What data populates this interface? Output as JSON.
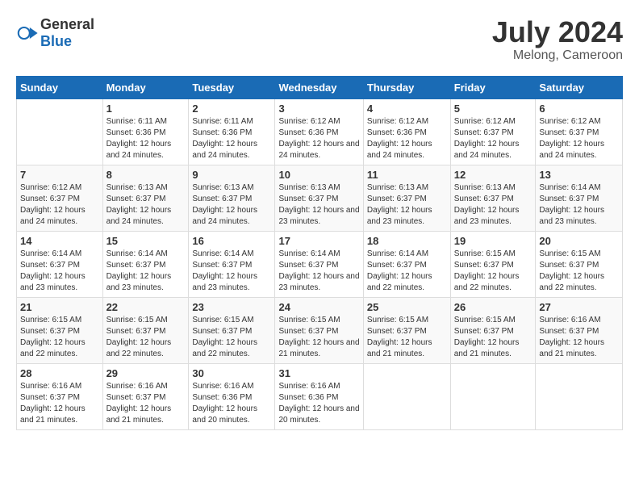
{
  "header": {
    "logo_general": "General",
    "logo_blue": "Blue",
    "month_year": "July 2024",
    "location": "Melong, Cameroon"
  },
  "weekdays": [
    "Sunday",
    "Monday",
    "Tuesday",
    "Wednesday",
    "Thursday",
    "Friday",
    "Saturday"
  ],
  "weeks": [
    [
      {
        "day": "",
        "sunrise": "",
        "sunset": "",
        "daylight": ""
      },
      {
        "day": "1",
        "sunrise": "6:11 AM",
        "sunset": "6:36 PM",
        "daylight": "12 hours and 24 minutes."
      },
      {
        "day": "2",
        "sunrise": "6:11 AM",
        "sunset": "6:36 PM",
        "daylight": "12 hours and 24 minutes."
      },
      {
        "day": "3",
        "sunrise": "6:12 AM",
        "sunset": "6:36 PM",
        "daylight": "12 hours and 24 minutes."
      },
      {
        "day": "4",
        "sunrise": "6:12 AM",
        "sunset": "6:36 PM",
        "daylight": "12 hours and 24 minutes."
      },
      {
        "day": "5",
        "sunrise": "6:12 AM",
        "sunset": "6:37 PM",
        "daylight": "12 hours and 24 minutes."
      },
      {
        "day": "6",
        "sunrise": "6:12 AM",
        "sunset": "6:37 PM",
        "daylight": "12 hours and 24 minutes."
      }
    ],
    [
      {
        "day": "7",
        "sunrise": "6:12 AM",
        "sunset": "6:37 PM",
        "daylight": "12 hours and 24 minutes."
      },
      {
        "day": "8",
        "sunrise": "6:13 AM",
        "sunset": "6:37 PM",
        "daylight": "12 hours and 24 minutes."
      },
      {
        "day": "9",
        "sunrise": "6:13 AM",
        "sunset": "6:37 PM",
        "daylight": "12 hours and 24 minutes."
      },
      {
        "day": "10",
        "sunrise": "6:13 AM",
        "sunset": "6:37 PM",
        "daylight": "12 hours and 23 minutes."
      },
      {
        "day": "11",
        "sunrise": "6:13 AM",
        "sunset": "6:37 PM",
        "daylight": "12 hours and 23 minutes."
      },
      {
        "day": "12",
        "sunrise": "6:13 AM",
        "sunset": "6:37 PM",
        "daylight": "12 hours and 23 minutes."
      },
      {
        "day": "13",
        "sunrise": "6:14 AM",
        "sunset": "6:37 PM",
        "daylight": "12 hours and 23 minutes."
      }
    ],
    [
      {
        "day": "14",
        "sunrise": "6:14 AM",
        "sunset": "6:37 PM",
        "daylight": "12 hours and 23 minutes."
      },
      {
        "day": "15",
        "sunrise": "6:14 AM",
        "sunset": "6:37 PM",
        "daylight": "12 hours and 23 minutes."
      },
      {
        "day": "16",
        "sunrise": "6:14 AM",
        "sunset": "6:37 PM",
        "daylight": "12 hours and 23 minutes."
      },
      {
        "day": "17",
        "sunrise": "6:14 AM",
        "sunset": "6:37 PM",
        "daylight": "12 hours and 23 minutes."
      },
      {
        "day": "18",
        "sunrise": "6:14 AM",
        "sunset": "6:37 PM",
        "daylight": "12 hours and 22 minutes."
      },
      {
        "day": "19",
        "sunrise": "6:15 AM",
        "sunset": "6:37 PM",
        "daylight": "12 hours and 22 minutes."
      },
      {
        "day": "20",
        "sunrise": "6:15 AM",
        "sunset": "6:37 PM",
        "daylight": "12 hours and 22 minutes."
      }
    ],
    [
      {
        "day": "21",
        "sunrise": "6:15 AM",
        "sunset": "6:37 PM",
        "daylight": "12 hours and 22 minutes."
      },
      {
        "day": "22",
        "sunrise": "6:15 AM",
        "sunset": "6:37 PM",
        "daylight": "12 hours and 22 minutes."
      },
      {
        "day": "23",
        "sunrise": "6:15 AM",
        "sunset": "6:37 PM",
        "daylight": "12 hours and 22 minutes."
      },
      {
        "day": "24",
        "sunrise": "6:15 AM",
        "sunset": "6:37 PM",
        "daylight": "12 hours and 21 minutes."
      },
      {
        "day": "25",
        "sunrise": "6:15 AM",
        "sunset": "6:37 PM",
        "daylight": "12 hours and 21 minutes."
      },
      {
        "day": "26",
        "sunrise": "6:15 AM",
        "sunset": "6:37 PM",
        "daylight": "12 hours and 21 minutes."
      },
      {
        "day": "27",
        "sunrise": "6:16 AM",
        "sunset": "6:37 PM",
        "daylight": "12 hours and 21 minutes."
      }
    ],
    [
      {
        "day": "28",
        "sunrise": "6:16 AM",
        "sunset": "6:37 PM",
        "daylight": "12 hours and 21 minutes."
      },
      {
        "day": "29",
        "sunrise": "6:16 AM",
        "sunset": "6:37 PM",
        "daylight": "12 hours and 21 minutes."
      },
      {
        "day": "30",
        "sunrise": "6:16 AM",
        "sunset": "6:36 PM",
        "daylight": "12 hours and 20 minutes."
      },
      {
        "day": "31",
        "sunrise": "6:16 AM",
        "sunset": "6:36 PM",
        "daylight": "12 hours and 20 minutes."
      },
      {
        "day": "",
        "sunrise": "",
        "sunset": "",
        "daylight": ""
      },
      {
        "day": "",
        "sunrise": "",
        "sunset": "",
        "daylight": ""
      },
      {
        "day": "",
        "sunrise": "",
        "sunset": "",
        "daylight": ""
      }
    ]
  ]
}
